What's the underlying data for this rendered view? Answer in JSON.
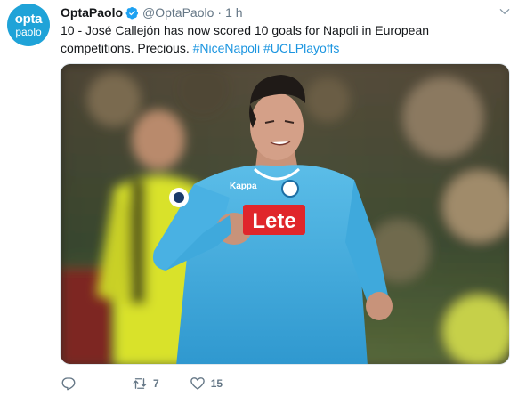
{
  "tweet": {
    "avatar": {
      "line1": "opta",
      "line2": "paolo"
    },
    "display_name": "OptaPaolo",
    "handle": "@OptaPaolo",
    "separator": "·",
    "time": "1 h",
    "text_main": "10 - José Callejón has now scored 10 goals for Napoli in European competitions. Precious. ",
    "hashtags": [
      "#NiceNapoli",
      "#UCLPlayoffs"
    ],
    "media": {
      "shirt_sponsor": "Lete",
      "shirt_brand": "Kappa"
    },
    "actions": {
      "reply_count": "",
      "retweet_count": "7",
      "like_count": "15"
    }
  },
  "colors": {
    "accent": "#1b95e0",
    "avatar_bg": "#1fa3d8",
    "muted": "#657786",
    "napoli_blue": "#3fa9dc",
    "referee_yellow": "#d9e22a"
  },
  "icons": {
    "verified": "verified-badge-icon",
    "caret": "chevron-down-icon",
    "reply": "reply-icon",
    "retweet": "retweet-icon",
    "like": "heart-icon"
  }
}
